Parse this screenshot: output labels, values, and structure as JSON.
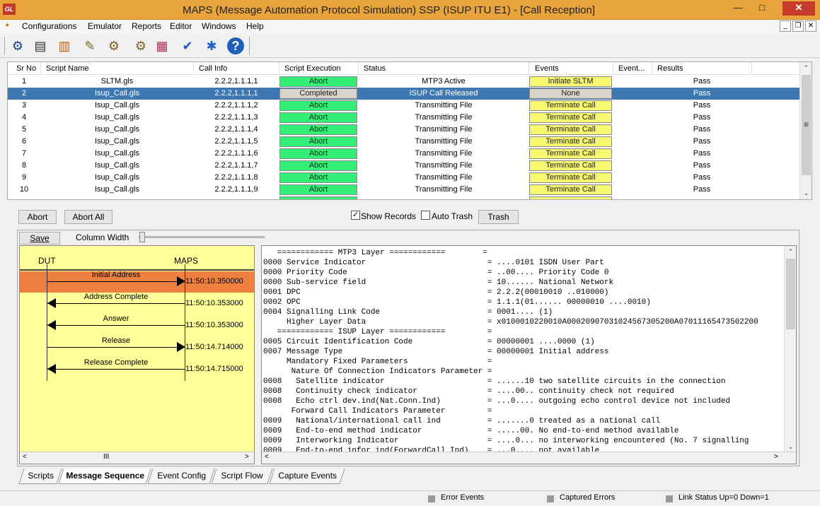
{
  "window": {
    "title": "MAPS (Message Automation Protocol Simulation) SSP (ISUP ITU E1) - [Call Reception]",
    "app_icon": "GL",
    "min_glyph": "—",
    "max_glyph": "□",
    "close_glyph": "✕"
  },
  "menu": {
    "items": [
      "Configurations",
      "Emulator",
      "Reports",
      "Editor",
      "Windows",
      "Help"
    ],
    "mdi_min": "_",
    "mdi_restore": "❐",
    "mdi_close": "✕"
  },
  "toolbar": {
    "icons": [
      "gear-icon",
      "notebook-icon",
      "briefcase-icon",
      "script-edit-icon",
      "gears-icon",
      "gear-pair-icon",
      "books-icon",
      "checklist-icon",
      "tools-icon",
      "help-icon"
    ],
    "glyphs": [
      "⚙",
      "▤",
      "▥",
      "✎",
      "⚙",
      "⚙",
      "▦",
      "✔",
      "✱",
      "?"
    ]
  },
  "grid": {
    "headers": [
      "Sr No",
      "Script Name",
      "Call Info",
      "Script Execution",
      "Status",
      "Events",
      "Event...",
      "Results"
    ],
    "rows": [
      {
        "sr": "1",
        "script": "SLTM.gls",
        "call": "2.2.2,1.1.1,1",
        "exec": "Abort",
        "status": "MTP3 Active",
        "event": "Initiate SLTM",
        "result": "Pass"
      },
      {
        "sr": "2",
        "script": "Isup_Call.gls",
        "call": "2.2.2,1.1.1,1",
        "exec": "Completed",
        "status": "ISUP Call Released",
        "event": "None",
        "result": "Pass"
      },
      {
        "sr": "3",
        "script": "Isup_Call.gls",
        "call": "2.2.2,1.1.1,2",
        "exec": "Abort",
        "status": "Transmitting File",
        "event": "Terminate Call",
        "result": "Pass"
      },
      {
        "sr": "4",
        "script": "Isup_Call.gls",
        "call": "2.2.2,1.1.1,3",
        "exec": "Abort",
        "status": "Transmitting File",
        "event": "Terminate Call",
        "result": "Pass"
      },
      {
        "sr": "5",
        "script": "Isup_Call.gls",
        "call": "2.2.2,1.1.1,4",
        "exec": "Abort",
        "status": "Transmitting File",
        "event": "Terminate Call",
        "result": "Pass"
      },
      {
        "sr": "6",
        "script": "Isup_Call.gls",
        "call": "2.2.2,1.1.1,5",
        "exec": "Abort",
        "status": "Transmitting File",
        "event": "Terminate Call",
        "result": "Pass"
      },
      {
        "sr": "7",
        "script": "Isup_Call.gls",
        "call": "2.2.2,1.1.1,6",
        "exec": "Abort",
        "status": "Transmitting File",
        "event": "Terminate Call",
        "result": "Pass"
      },
      {
        "sr": "8",
        "script": "Isup_Call.gls",
        "call": "2.2.2,1.1.1,7",
        "exec": "Abort",
        "status": "Transmitting File",
        "event": "Terminate Call",
        "result": "Pass"
      },
      {
        "sr": "9",
        "script": "Isup_Call.gls",
        "call": "2.2.2,1.1.1,8",
        "exec": "Abort",
        "status": "Transmitting File",
        "event": "Terminate Call",
        "result": "Pass"
      },
      {
        "sr": "10",
        "script": "Isup_Call.gls",
        "call": "2.2.2,1.1.1,9",
        "exec": "Abort",
        "status": "Transmitting File",
        "event": "Terminate Call",
        "result": "Pass"
      }
    ],
    "scroll_up": "⌃",
    "scroll_down": "⌄",
    "scroll_grip": "≡"
  },
  "controls": {
    "abort": "Abort",
    "abort_all": "Abort All",
    "show_records": "Show Records",
    "show_records_checked": "✓",
    "auto_trash": "Auto Trash",
    "trash": "Trash",
    "save": "Save",
    "column_width": "Column Width"
  },
  "sequence": {
    "left_label": "DUT",
    "right_label": "MAPS",
    "messages": [
      {
        "label": "Initial Address",
        "time": "11:50:10.350000",
        "dir": "right"
      },
      {
        "label": "Address Complete",
        "time": "11:50:10.353000",
        "dir": "left"
      },
      {
        "label": "Answer",
        "time": "11:50:10.353000",
        "dir": "left"
      },
      {
        "label": "Release",
        "time": "11:50:14.714000",
        "dir": "right"
      },
      {
        "label": "Release Complete",
        "time": "11:50:14.715000",
        "dir": "left"
      }
    ],
    "scroll_left": "<",
    "scroll_right": ">",
    "scroll_grip": "III"
  },
  "decode": {
    "lines": [
      "   ============ MTP3 Layer ============        =",
      "0000 Service Indicator                          = ....0101 ISDN User Part",
      "0000 Priority Code                              = ..00.... Priority Code 0",
      "0000 Sub-service field                          = 10...... National Network",
      "0001 DPC                                        = 2.2.2(00010010 ..010000)",
      "0002 OPC                                        = 1.1.1(01...... 00000010 ....0010)",
      "0004 Signalling Link Code                       = 0001.... (1)",
      "     Higher Layer Data                          = x0100010220010A00020907031024567305200A07011165473502200",
      "   ============ ISUP Layer ============         =",
      "0005 Circuit Identification Code                = 00000001 ....0000 (1)",
      "0007 Message Type                               = 00000001 Initial address",
      "     Mandatory Fixed Parameters                 =",
      "      Nature Of Connection Indicators Parameter =",
      "0008   Satellite indicator                      = ......10 two satellite circuits in the connection",
      "0008   Continuity check indicator               = ....00.. continuity check not required",
      "0008   Echo ctrl dev.ind(Nat.Conn.Ind)          = ...0.... outgoing echo control device not included",
      "      Forward Call Indicators Parameter         =",
      "0009   National/international call ind          = .......0 treated as a national call",
      "0009   End-to-end method indicator              = .....00. No end-to-end method available",
      "0009   Interworking Indicator                   = ....0... no interworking encountered (No. 7 signalling",
      "0009   End-to-end infor ind(ForwardCall Ind)    = ...0.... not available"
    ]
  },
  "tabs": [
    "Scripts",
    "Message Sequence",
    "Event Config",
    "Script Flow",
    "Capture Events"
  ],
  "status": {
    "error_events": "Error Events",
    "captured_errors": "Captured Errors",
    "link_status": "Link Status Up=0 Down=1"
  }
}
